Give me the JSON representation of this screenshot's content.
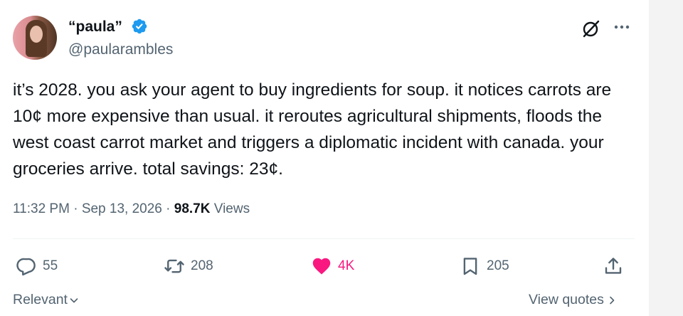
{
  "author": {
    "display_name": "“paula”",
    "handle": "@paularambles",
    "verified": true
  },
  "tweet": {
    "text": "it’s 2028. you ask your agent to buy ingredients for soup. it notices carrots are 10¢ more expensive than usual. it reroutes agricultural shipments, floods the west coast carrot market and triggers a diplomatic incident with canada. your groceries arrive. total savings: 23¢."
  },
  "meta": {
    "time": "11:32 PM",
    "separator": " · ",
    "date": "Sep 13, 2026",
    "views_count": "98.7K",
    "views_label": "Views"
  },
  "actions": {
    "replies": "55",
    "reposts": "208",
    "likes": "4K",
    "bookmarks": "205"
  },
  "footer": {
    "relevant_label": "Relevant",
    "view_quotes_label": "View quotes"
  },
  "colors": {
    "like": "#f91880",
    "verified": "#1d9bf0",
    "muted_text": "#536471"
  },
  "icons": [
    "grok-icon",
    "more-icon",
    "reply-icon",
    "repost-icon",
    "heart-icon",
    "bookmark-icon",
    "share-icon",
    "chevron-down-icon",
    "chevron-right-icon",
    "verified-badge-icon"
  ]
}
